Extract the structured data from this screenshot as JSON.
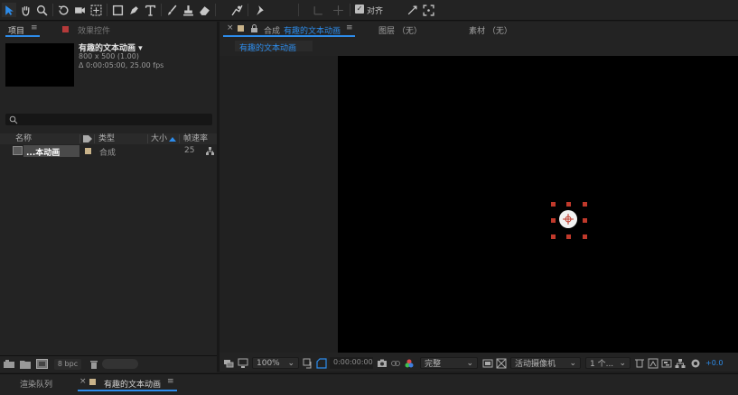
{
  "toolbar": {
    "align_label": "对齐"
  },
  "project_panel": {
    "tab_label": "项目",
    "menu_icon": "≡",
    "effects_tab_label": "效果控件",
    "comp_name": "有趣的文本动画 ▾",
    "comp_size": "800 x 500 (1.00)",
    "comp_duration": "Δ 0:00:05:00, 25.00 fps",
    "search_placeholder": "",
    "columns": {
      "name": "名称",
      "type": "类型",
      "size": "大小",
      "fps": "帧速率"
    },
    "items": [
      {
        "name": "...本动画",
        "type": "合成",
        "fps": "25"
      }
    ],
    "bpc_label": "8 bpc"
  },
  "comp_panel": {
    "close_symbol": "×",
    "tab_prefix": "合成",
    "tab_name": "有趣的文本动画",
    "menu_icon": "≡",
    "layer_tab": "图层 （无）",
    "footage_tab": "素材 （无）",
    "breadcrumb": "有趣的文本动画",
    "zoom": "100%",
    "timecode": "0:00:00:00",
    "resolution": "完整",
    "camera": "活动摄像机",
    "views": "1 个...",
    "exposure": "+0.0"
  },
  "bottom_tabs": {
    "render_queue": "渲染队列",
    "close_symbol": "×",
    "timeline_name": "有趣的文本动画",
    "menu_icon": "≡"
  },
  "colors": {
    "accent": "#2d8ceb",
    "label_swatch": "#c9b38a",
    "handle_red": "#c0392b"
  }
}
